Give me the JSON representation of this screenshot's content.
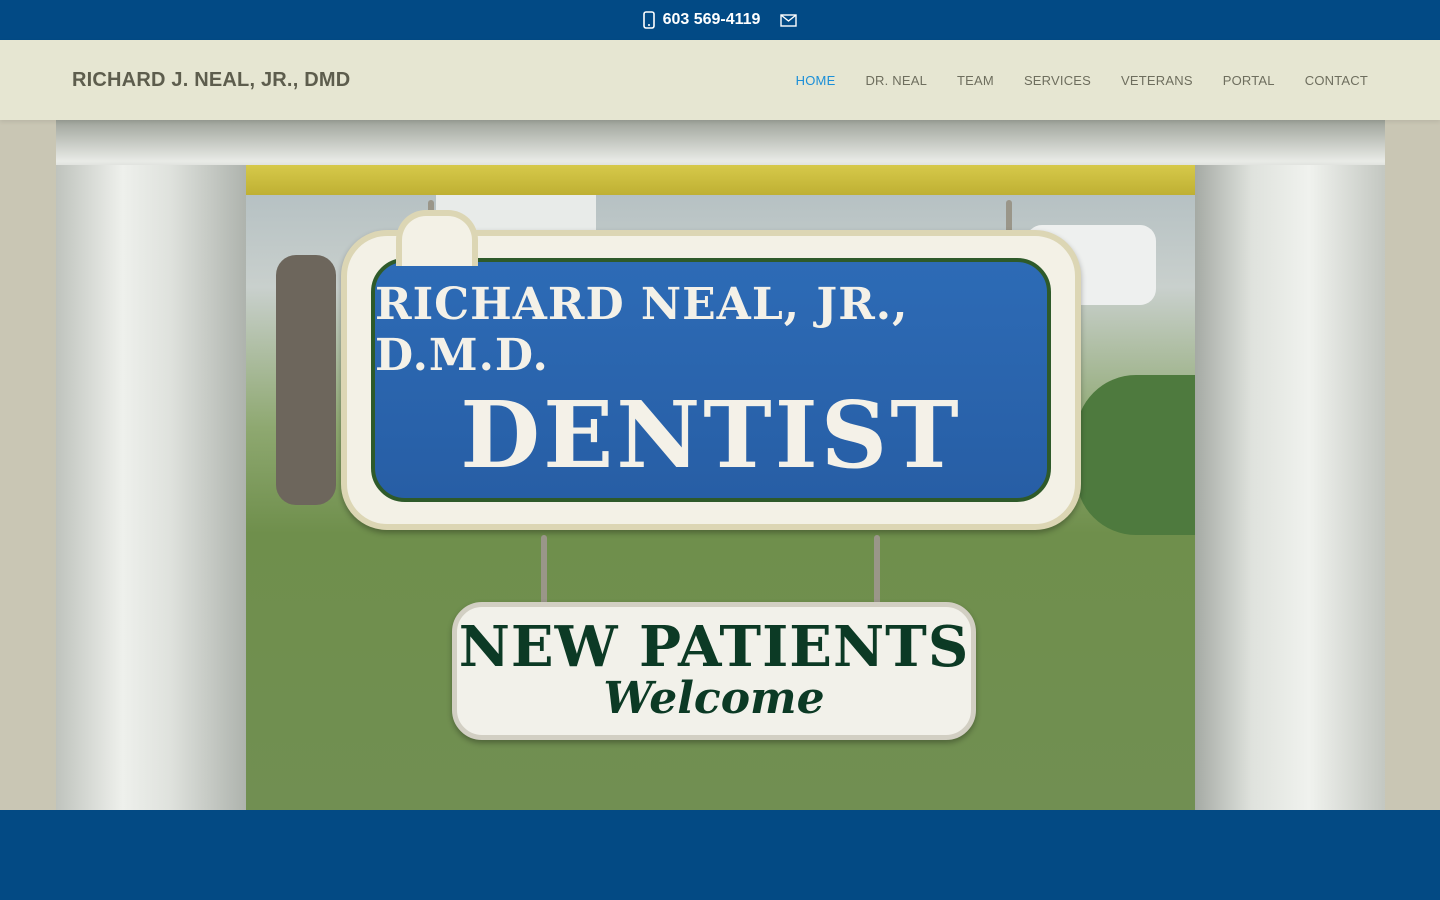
{
  "topbar": {
    "phone": "603 569-4119",
    "phone_icon": "mobile-phone-icon",
    "email_icon": "envelope-icon"
  },
  "header": {
    "logo": "RICHARD J. NEAL, JR., DMD",
    "nav": [
      {
        "label": "HOME",
        "active": true
      },
      {
        "label": "DR. NEAL"
      },
      {
        "label": "TEAM"
      },
      {
        "label": "SERVICES"
      },
      {
        "label": "VETERANS"
      },
      {
        "label": "PORTAL"
      },
      {
        "label": "CONTACT"
      }
    ]
  },
  "hero": {
    "sign_line1": "RICHARD NEAL, JR., D.M.D.",
    "sign_line2": "DENTIST",
    "sub_line1": "NEW PATIENTS",
    "sub_line2": "Welcome"
  },
  "colors": {
    "brand_blue": "#024a85",
    "header_bg": "#e6e6d2",
    "nav_active": "#1b8fd8"
  }
}
